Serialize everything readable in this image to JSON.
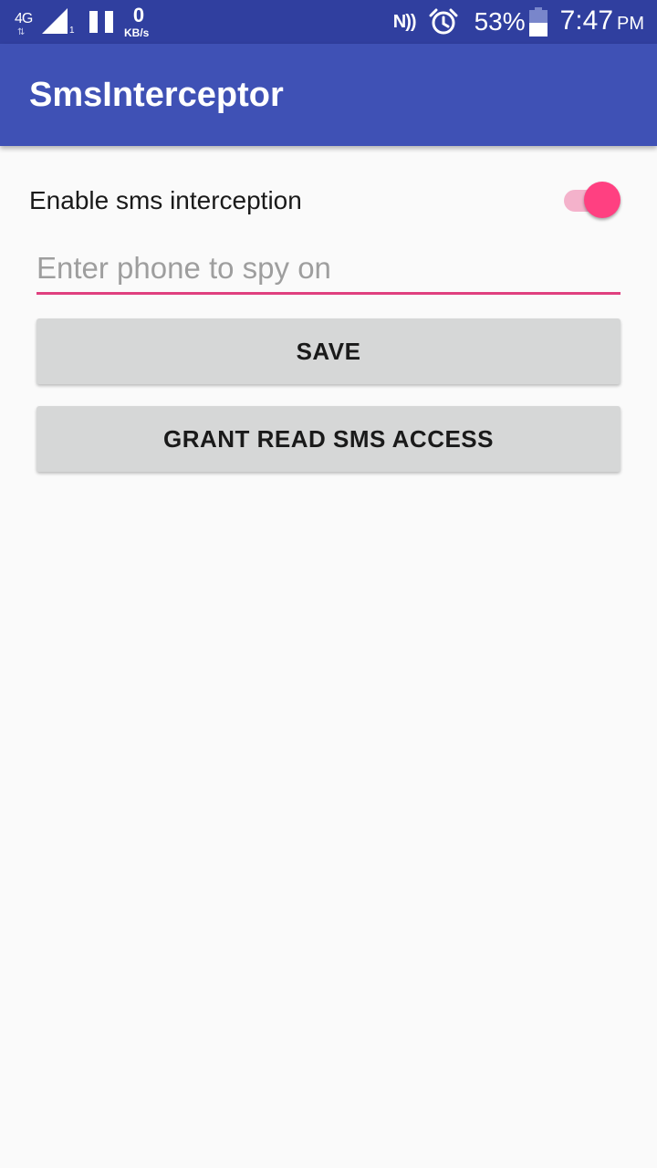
{
  "status_bar": {
    "network_type": "4G",
    "network_arrows": "⇅",
    "sim_slot": "1",
    "speed_value": "0",
    "speed_unit": "KB/s",
    "nfc_label": "N))",
    "battery_percent": "53%",
    "battery_level": 0.53,
    "time": "7:47",
    "ampm": "PM",
    "icons": [
      "signal-icon",
      "pause-icon",
      "nfc-icon",
      "alarm-icon",
      "battery-icon"
    ]
  },
  "app_bar": {
    "title": "SmsInterceptor",
    "color": "#3f51b5",
    "status_color": "#303f9f"
  },
  "settings": {
    "enable_label": "Enable sms interception",
    "enabled": true,
    "accent_color": "#ff4081"
  },
  "phone": {
    "placeholder": "Enter phone to spy on",
    "value": ""
  },
  "buttons": {
    "save": "SAVE",
    "grant": "GRANT READ SMS ACCESS"
  }
}
